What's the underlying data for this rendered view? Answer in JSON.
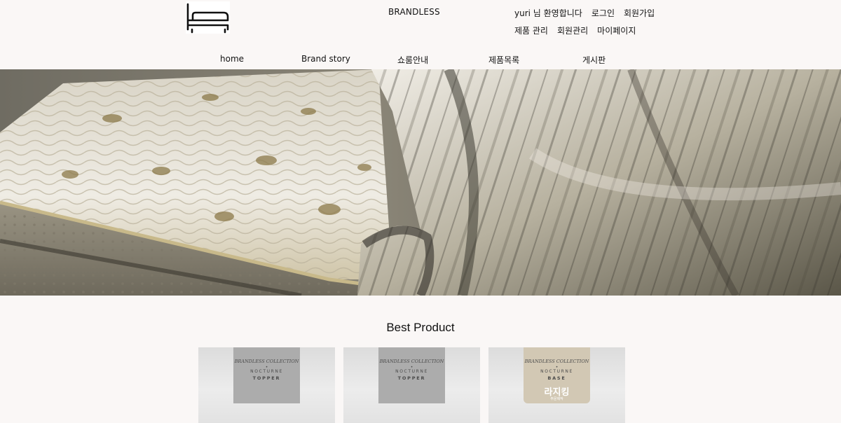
{
  "header": {
    "logo_icon": "bed-icon",
    "brand": "BRANDLESS",
    "util_row1": [
      "yuri 님 환영합니다",
      "로그인",
      "회원가입"
    ],
    "util_row2": [
      "제품 관리",
      "회원관리",
      "마이페이지"
    ]
  },
  "nav": [
    "home",
    "Brand story",
    "쇼룸안내",
    "제품목록",
    "게시판"
  ],
  "section": {
    "title": "Best Product"
  },
  "products": [
    {
      "collection": "BRANDLESS COLLECTION",
      "dot": "•",
      "line": "NOCTURNE",
      "name": "TOPPER"
    },
    {
      "collection": "BRANDLESS COLLECTION",
      "dot": "•",
      "line": "NOCTURNE",
      "name": "TOPPER"
    },
    {
      "collection": "BRANDLESS COLLECTION",
      "dot": "•",
      "line": "NOCTURNE",
      "name": "BASE",
      "size": "라지킹",
      "note": "주문제작"
    }
  ]
}
